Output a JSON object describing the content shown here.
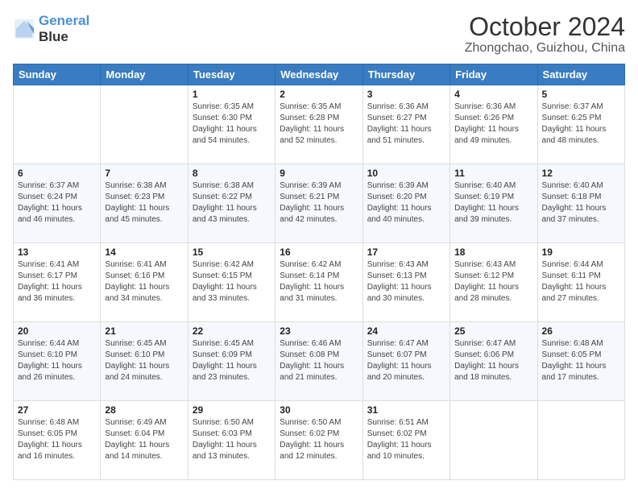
{
  "logo": {
    "line1": "General",
    "line2": "Blue"
  },
  "title": "October 2024",
  "subtitle": "Zhongchao, Guizhou, China",
  "days": [
    "Sunday",
    "Monday",
    "Tuesday",
    "Wednesday",
    "Thursday",
    "Friday",
    "Saturday"
  ],
  "weeks": [
    [
      {
        "day": "",
        "content": ""
      },
      {
        "day": "",
        "content": ""
      },
      {
        "day": "1",
        "content": "Sunrise: 6:35 AM\nSunset: 6:30 PM\nDaylight: 11 hours and 54 minutes."
      },
      {
        "day": "2",
        "content": "Sunrise: 6:35 AM\nSunset: 6:28 PM\nDaylight: 11 hours and 52 minutes."
      },
      {
        "day": "3",
        "content": "Sunrise: 6:36 AM\nSunset: 6:27 PM\nDaylight: 11 hours and 51 minutes."
      },
      {
        "day": "4",
        "content": "Sunrise: 6:36 AM\nSunset: 6:26 PM\nDaylight: 11 hours and 49 minutes."
      },
      {
        "day": "5",
        "content": "Sunrise: 6:37 AM\nSunset: 6:25 PM\nDaylight: 11 hours and 48 minutes."
      }
    ],
    [
      {
        "day": "6",
        "content": "Sunrise: 6:37 AM\nSunset: 6:24 PM\nDaylight: 11 hours and 46 minutes."
      },
      {
        "day": "7",
        "content": "Sunrise: 6:38 AM\nSunset: 6:23 PM\nDaylight: 11 hours and 45 minutes."
      },
      {
        "day": "8",
        "content": "Sunrise: 6:38 AM\nSunset: 6:22 PM\nDaylight: 11 hours and 43 minutes."
      },
      {
        "day": "9",
        "content": "Sunrise: 6:39 AM\nSunset: 6:21 PM\nDaylight: 11 hours and 42 minutes."
      },
      {
        "day": "10",
        "content": "Sunrise: 6:39 AM\nSunset: 6:20 PM\nDaylight: 11 hours and 40 minutes."
      },
      {
        "day": "11",
        "content": "Sunrise: 6:40 AM\nSunset: 6:19 PM\nDaylight: 11 hours and 39 minutes."
      },
      {
        "day": "12",
        "content": "Sunrise: 6:40 AM\nSunset: 6:18 PM\nDaylight: 11 hours and 37 minutes."
      }
    ],
    [
      {
        "day": "13",
        "content": "Sunrise: 6:41 AM\nSunset: 6:17 PM\nDaylight: 11 hours and 36 minutes."
      },
      {
        "day": "14",
        "content": "Sunrise: 6:41 AM\nSunset: 6:16 PM\nDaylight: 11 hours and 34 minutes."
      },
      {
        "day": "15",
        "content": "Sunrise: 6:42 AM\nSunset: 6:15 PM\nDaylight: 11 hours and 33 minutes."
      },
      {
        "day": "16",
        "content": "Sunrise: 6:42 AM\nSunset: 6:14 PM\nDaylight: 11 hours and 31 minutes."
      },
      {
        "day": "17",
        "content": "Sunrise: 6:43 AM\nSunset: 6:13 PM\nDaylight: 11 hours and 30 minutes."
      },
      {
        "day": "18",
        "content": "Sunrise: 6:43 AM\nSunset: 6:12 PM\nDaylight: 11 hours and 28 minutes."
      },
      {
        "day": "19",
        "content": "Sunrise: 6:44 AM\nSunset: 6:11 PM\nDaylight: 11 hours and 27 minutes."
      }
    ],
    [
      {
        "day": "20",
        "content": "Sunrise: 6:44 AM\nSunset: 6:10 PM\nDaylight: 11 hours and 26 minutes."
      },
      {
        "day": "21",
        "content": "Sunrise: 6:45 AM\nSunset: 6:10 PM\nDaylight: 11 hours and 24 minutes."
      },
      {
        "day": "22",
        "content": "Sunrise: 6:45 AM\nSunset: 6:09 PM\nDaylight: 11 hours and 23 minutes."
      },
      {
        "day": "23",
        "content": "Sunrise: 6:46 AM\nSunset: 6:08 PM\nDaylight: 11 hours and 21 minutes."
      },
      {
        "day": "24",
        "content": "Sunrise: 6:47 AM\nSunset: 6:07 PM\nDaylight: 11 hours and 20 minutes."
      },
      {
        "day": "25",
        "content": "Sunrise: 6:47 AM\nSunset: 6:06 PM\nDaylight: 11 hours and 18 minutes."
      },
      {
        "day": "26",
        "content": "Sunrise: 6:48 AM\nSunset: 6:05 PM\nDaylight: 11 hours and 17 minutes."
      }
    ],
    [
      {
        "day": "27",
        "content": "Sunrise: 6:48 AM\nSunset: 6:05 PM\nDaylight: 11 hours and 16 minutes."
      },
      {
        "day": "28",
        "content": "Sunrise: 6:49 AM\nSunset: 6:04 PM\nDaylight: 11 hours and 14 minutes."
      },
      {
        "day": "29",
        "content": "Sunrise: 6:50 AM\nSunset: 6:03 PM\nDaylight: 11 hours and 13 minutes."
      },
      {
        "day": "30",
        "content": "Sunrise: 6:50 AM\nSunset: 6:02 PM\nDaylight: 11 hours and 12 minutes."
      },
      {
        "day": "31",
        "content": "Sunrise: 6:51 AM\nSunset: 6:02 PM\nDaylight: 11 hours and 10 minutes."
      },
      {
        "day": "",
        "content": ""
      },
      {
        "day": "",
        "content": ""
      }
    ]
  ]
}
